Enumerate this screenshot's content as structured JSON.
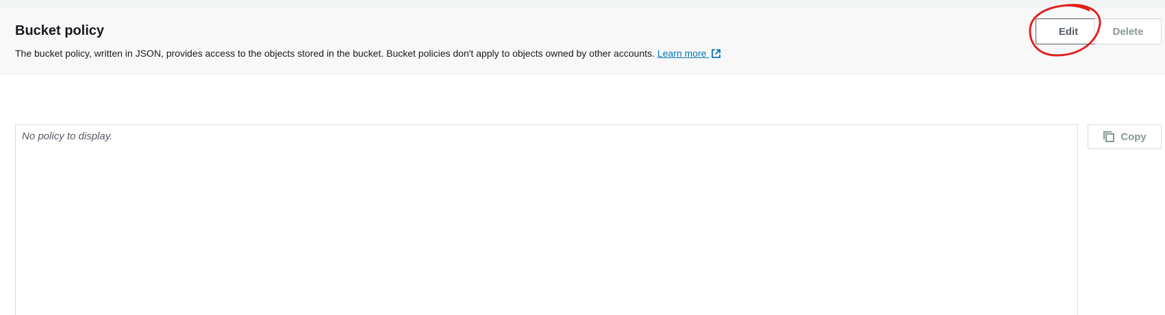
{
  "bucket_policy": {
    "title": "Bucket policy",
    "description": "The bucket policy, written in JSON, provides access to the objects stored in the bucket. Bucket policies don't apply to objects owned by other accounts.",
    "learn_more_label": "Learn more",
    "edit_label": "Edit",
    "delete_label": "Delete",
    "empty_message": "No policy to display.",
    "copy_label": "Copy"
  },
  "icons": {
    "learn_more": "external-link-icon",
    "copy": "copy-icon"
  },
  "colors": {
    "link": "#0073bb",
    "annotation": "#e0201c",
    "text": "#16191f",
    "disabled": "#879596"
  }
}
